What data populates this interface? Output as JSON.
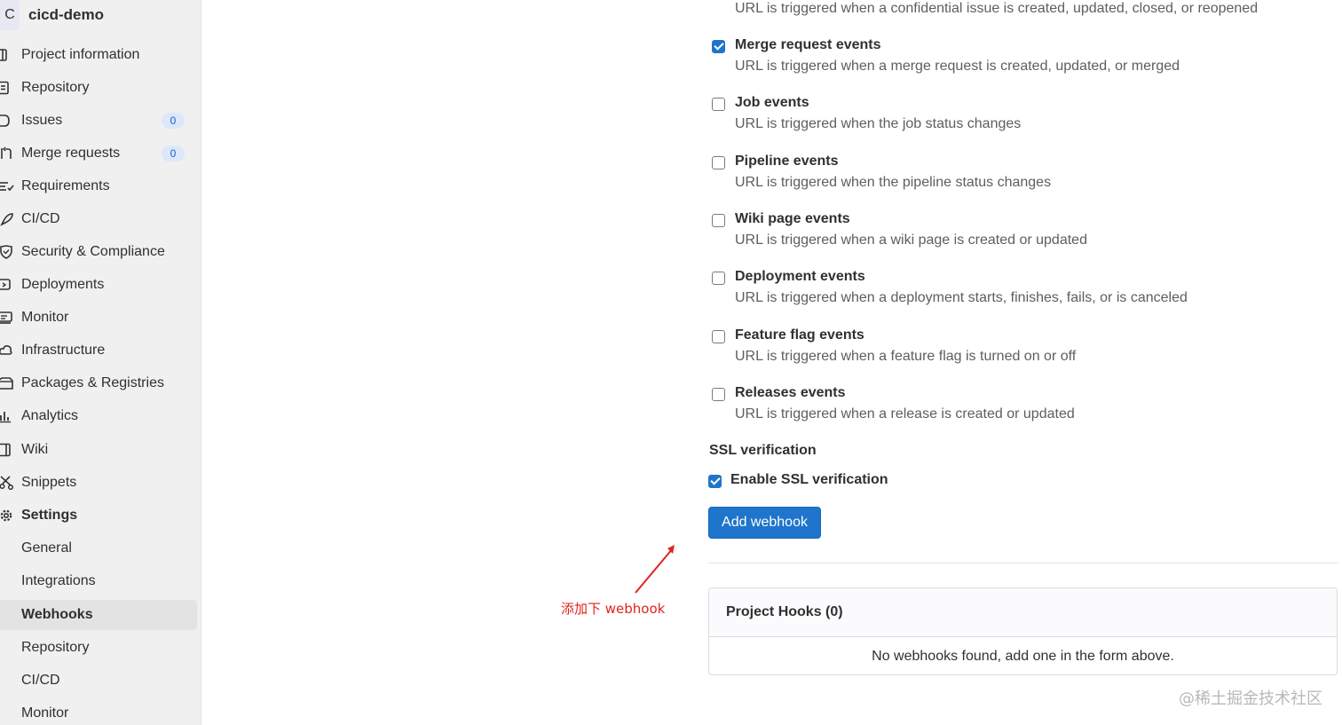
{
  "sidebar": {
    "project_avatar": "C",
    "project_name": "cicd-demo",
    "items": [
      {
        "label": "Project information",
        "icon": "project-info-icon"
      },
      {
        "label": "Repository",
        "icon": "repository-icon"
      },
      {
        "label": "Issues",
        "icon": "issues-icon",
        "badge": "0"
      },
      {
        "label": "Merge requests",
        "icon": "merge-request-icon",
        "badge": "0"
      },
      {
        "label": "Requirements",
        "icon": "requirements-icon"
      },
      {
        "label": "CI/CD",
        "icon": "rocket-icon"
      },
      {
        "label": "Security & Compliance",
        "icon": "shield-icon"
      },
      {
        "label": "Deployments",
        "icon": "deployments-icon"
      },
      {
        "label": "Monitor",
        "icon": "monitor-icon"
      },
      {
        "label": "Infrastructure",
        "icon": "cloud-icon"
      },
      {
        "label": "Packages & Registries",
        "icon": "package-icon"
      },
      {
        "label": "Analytics",
        "icon": "chart-icon"
      },
      {
        "label": "Wiki",
        "icon": "book-icon"
      },
      {
        "label": "Snippets",
        "icon": "scissors-icon"
      },
      {
        "label": "Settings",
        "icon": "gear-icon"
      }
    ],
    "settings_subitems": [
      {
        "label": "General"
      },
      {
        "label": "Integrations"
      },
      {
        "label": "Webhooks",
        "active": true
      },
      {
        "label": "Repository"
      },
      {
        "label": "CI/CD"
      },
      {
        "label": "Monitor"
      }
    ]
  },
  "main": {
    "confidential_issue_desc": "URL is triggered when a confidential issue is created, updated, closed, or reopened",
    "events": [
      {
        "title": "Merge request events",
        "desc": "URL is triggered when a merge request is created, updated, or merged",
        "checked": true
      },
      {
        "title": "Job events",
        "desc": "URL is triggered when the job status changes",
        "checked": false
      },
      {
        "title": "Pipeline events",
        "desc": "URL is triggered when the pipeline status changes",
        "checked": false
      },
      {
        "title": "Wiki page events",
        "desc": "URL is triggered when a wiki page is created or updated",
        "checked": false
      },
      {
        "title": "Deployment events",
        "desc": "URL is triggered when a deployment starts, finishes, fails, or is canceled",
        "checked": false
      },
      {
        "title": "Feature flag events",
        "desc": "URL is triggered when a feature flag is turned on or off",
        "checked": false
      },
      {
        "title": "Releases events",
        "desc": "URL is triggered when a release is created or updated",
        "checked": false
      }
    ],
    "ssl_heading": "SSL verification",
    "ssl_label": "Enable SSL verification",
    "ssl_checked": true,
    "add_button": "Add webhook",
    "hooks_header": "Project Hooks (0)",
    "hooks_empty": "No webhooks found, add one in the form above."
  },
  "annotation": {
    "text": "添加下 webhook",
    "color": "#e0241f"
  },
  "watermark": "@稀土掘金技术社区",
  "colors": {
    "accent": "#1f75cb",
    "sidebar_bg": "#f0f0f0",
    "badge_bg": "#dbe8fb"
  }
}
